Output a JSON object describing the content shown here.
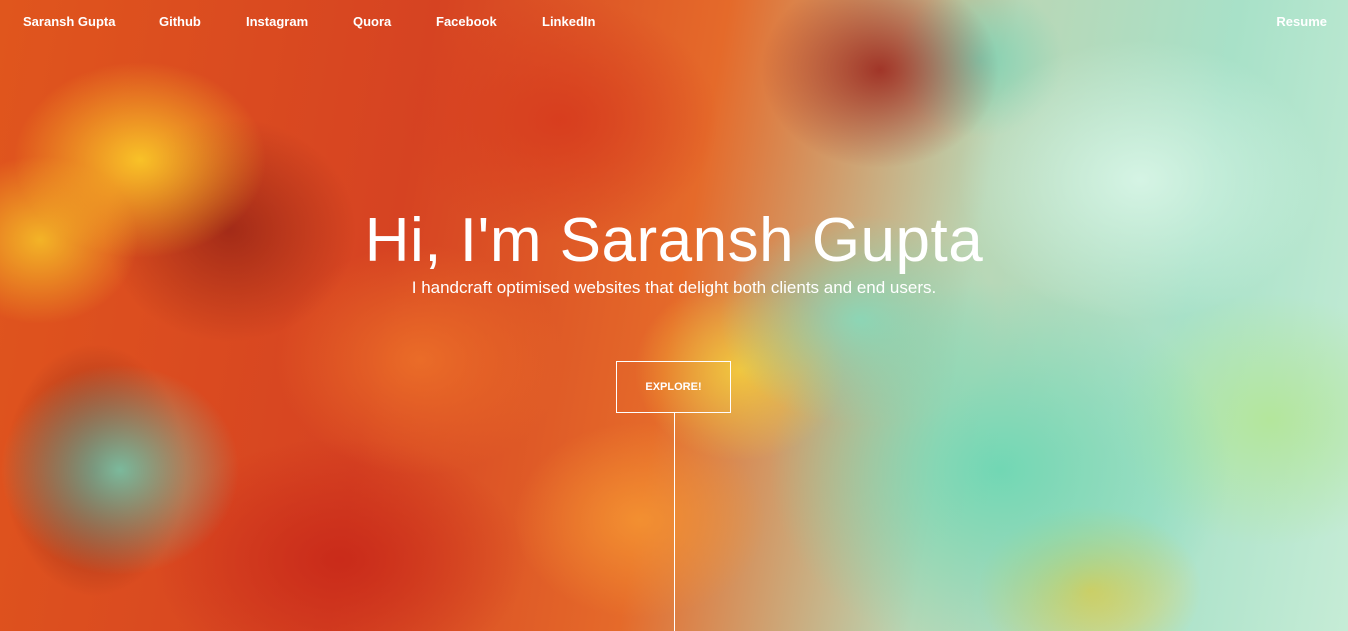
{
  "nav": {
    "brand": "Saransh Gupta",
    "links": [
      "Github",
      "Instagram",
      "Quora",
      "Facebook",
      "LinkedIn"
    ],
    "resume": "Resume"
  },
  "hero": {
    "title": "Hi, I'm Saransh Gupta",
    "subtitle": "I handcraft optimised websites that delight both clients and end users.",
    "button_label": "EXPLORE!"
  }
}
